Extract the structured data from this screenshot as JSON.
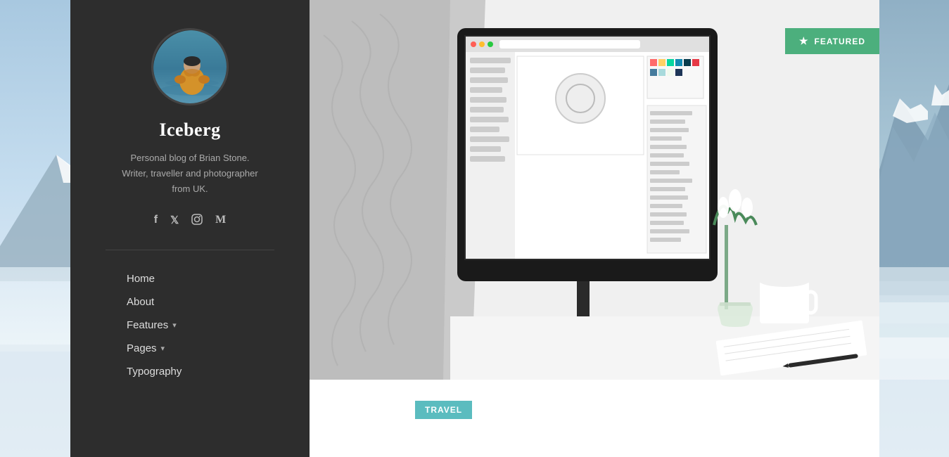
{
  "sidebar": {
    "title": "Iceberg",
    "description": "Personal blog of Brian Stone.\nWriter, traveller and photographer\nfrom UK.",
    "social": {
      "facebook": "f",
      "twitter": "🐦",
      "instagram": "⊡",
      "medium": "M"
    },
    "nav": [
      {
        "label": "Home",
        "hasDropdown": false
      },
      {
        "label": "About",
        "hasDropdown": false
      },
      {
        "label": "Features",
        "hasDropdown": true
      },
      {
        "label": "Pages",
        "hasDropdown": true
      },
      {
        "label": "Typography",
        "hasDropdown": false
      }
    ]
  },
  "featured_badge": {
    "label": "FEATURED",
    "icon": "star"
  },
  "travel_badge": {
    "label": "TRAVEL"
  },
  "colors": {
    "sidebar_bg": "#2d2d2d",
    "featured_green": "#4caf7d",
    "travel_teal": "#5bbcbf"
  }
}
